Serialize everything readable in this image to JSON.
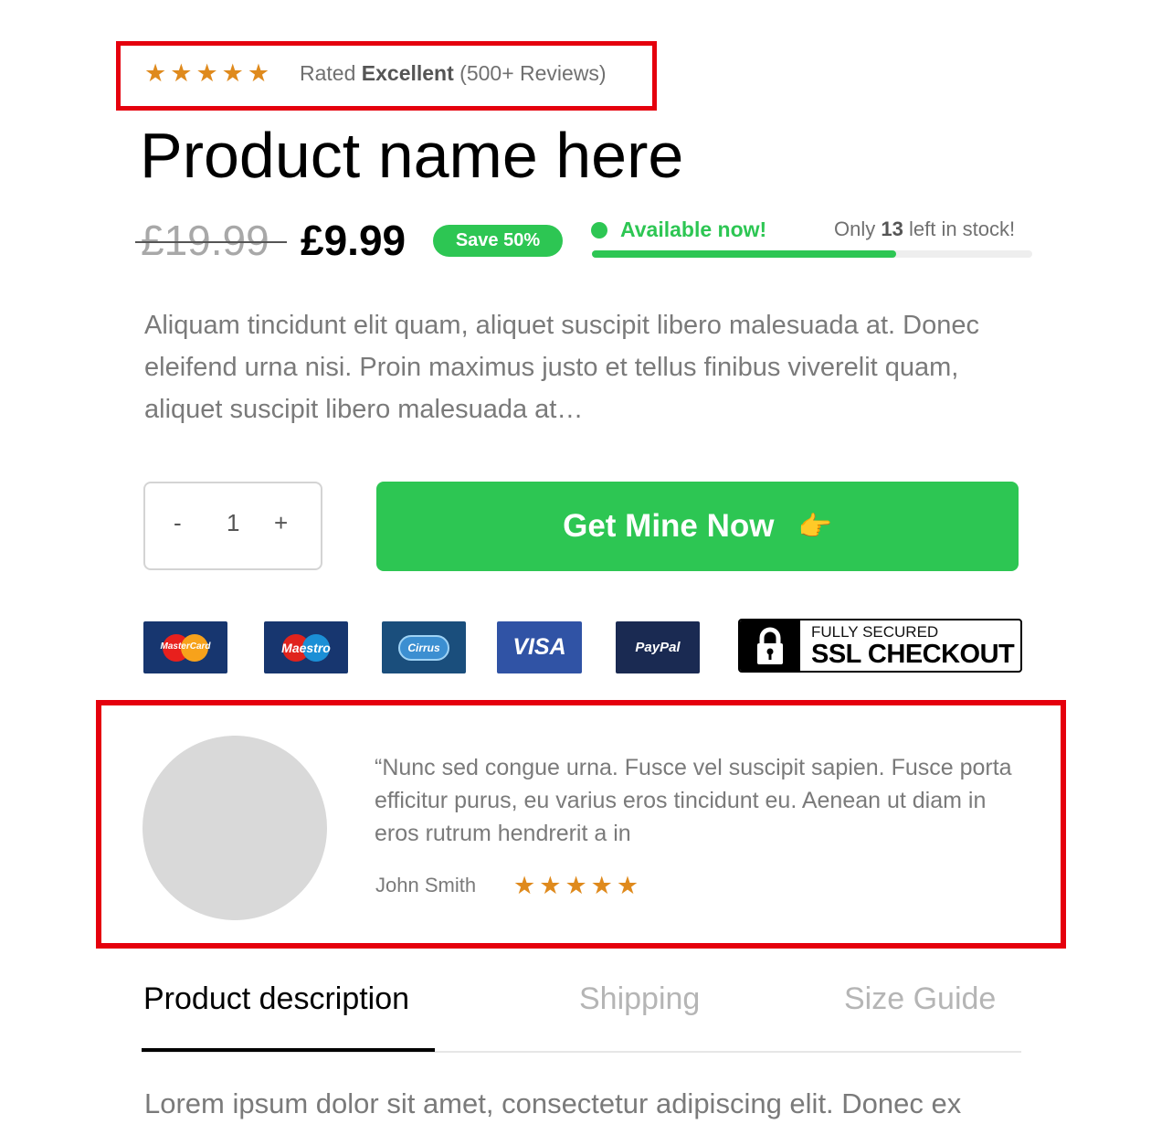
{
  "rating": {
    "stars": 5,
    "prefix": "Rated",
    "emphasis": "Excellent",
    "suffix": "(500+ Reviews)"
  },
  "product": {
    "title": "Product name here",
    "old_price": "£19.99",
    "new_price": "£9.99",
    "save_badge": "Save 50%",
    "availability": "Available now!",
    "stock_prefix": "Only",
    "stock_count": "13",
    "stock_suffix": "left in stock!",
    "stock_level": 0.69,
    "description": "Aliquam tincidunt elit quam, aliquet suscipit libero malesuada at. Donec eleifend urna nisi. Proin maximus justo et tellus finibus viverelit quam, aliquet suscipit libero malesuada at…"
  },
  "quantity": {
    "minus": "-",
    "value": "1",
    "plus": "+"
  },
  "cta": {
    "label": "Get Mine Now",
    "icon": "pointing-hand-icon"
  },
  "payments": {
    "mastercard": "MasterCard",
    "maestro": "Maestro",
    "cirrus": "Cirrus",
    "visa": "VISA",
    "paypal": "PayPal",
    "ssl_small": "FULLY SECURED",
    "ssl_big": "SSL CHECKOUT"
  },
  "testimonial": {
    "quote": "“Nunc sed congue urna. Fusce vel suscipit sapien. Fusce porta efficitur purus, eu varius eros tincidunt eu. Aenean ut diam in eros rutrum hendrerit a in",
    "author": "John Smith",
    "stars": 5
  },
  "tabs": [
    {
      "label": "Product description",
      "active": true
    },
    {
      "label": "Shipping",
      "active": false
    },
    {
      "label": "Size Guide",
      "active": false
    }
  ],
  "tab_content": "Lorem ipsum dolor sit amet, consectetur adipiscing elit. Donec ex",
  "colors": {
    "accent_green": "#2dc653",
    "star": "#df8a1d",
    "highlight_red": "#e5000d"
  }
}
